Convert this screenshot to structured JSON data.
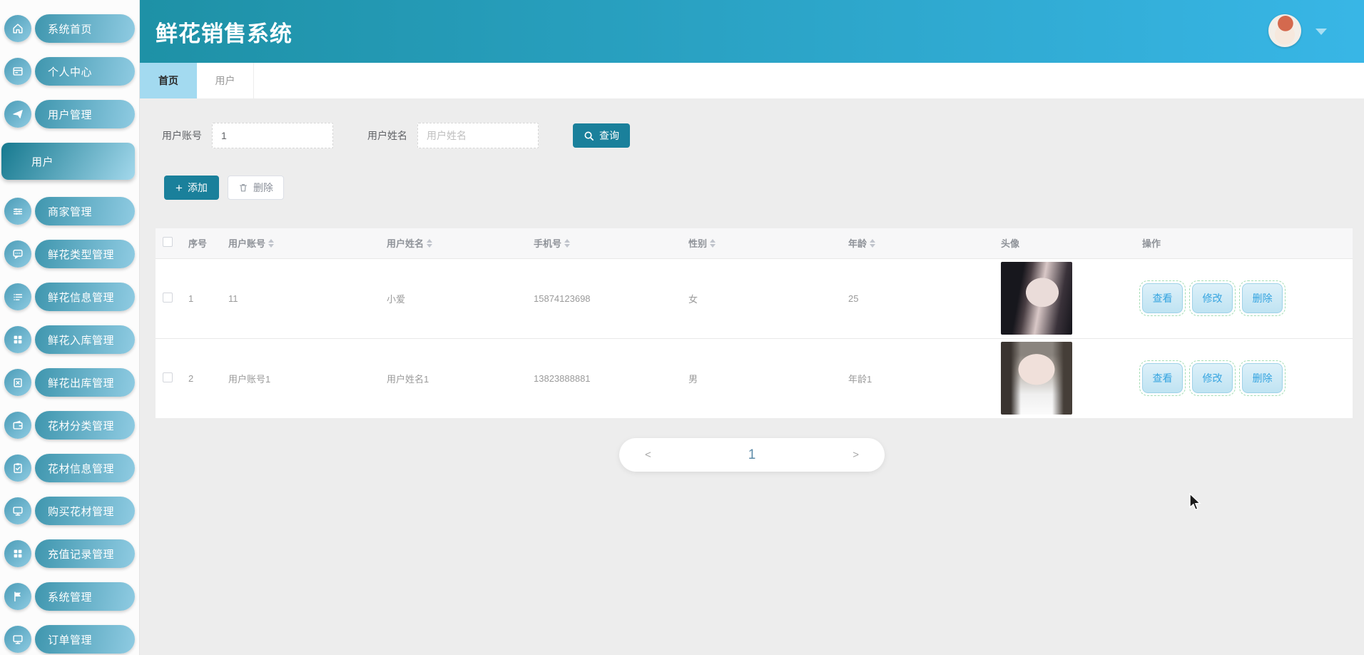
{
  "app": {
    "title": "鲜花销售系统"
  },
  "sidebar": {
    "items": [
      {
        "label": "系统首页"
      },
      {
        "label": "个人中心"
      },
      {
        "label": "用户管理"
      },
      {
        "label": "用户"
      },
      {
        "label": "商家管理"
      },
      {
        "label": "鲜花类型管理"
      },
      {
        "label": "鲜花信息管理"
      },
      {
        "label": "鲜花入库管理"
      },
      {
        "label": "鲜花出库管理"
      },
      {
        "label": "花材分类管理"
      },
      {
        "label": "花材信息管理"
      },
      {
        "label": "购买花材管理"
      },
      {
        "label": "充值记录管理"
      },
      {
        "label": "系统管理"
      },
      {
        "label": "订单管理"
      }
    ]
  },
  "tabs": {
    "home": "首页",
    "user": "用户"
  },
  "search": {
    "account_label": "用户账号",
    "account_value": "1",
    "name_label": "用户姓名",
    "name_placeholder": "用户姓名",
    "query_label": "查询"
  },
  "toolbar": {
    "add_label": "添加",
    "delete_label": "删除"
  },
  "table": {
    "columns": [
      "序号",
      "用户账号",
      "用户姓名",
      "手机号",
      "性别",
      "年龄",
      "头像",
      "操作"
    ],
    "row_actions": [
      "查看",
      "修改",
      "删除"
    ],
    "rows": [
      {
        "index": "1",
        "account": "11",
        "name": "小爱",
        "phone": "15874123698",
        "gender": "女",
        "age": "25"
      },
      {
        "index": "2",
        "account": "用户账号1",
        "name": "用户姓名1",
        "phone": "13823888881",
        "gender": "男",
        "age": "年龄1"
      }
    ]
  },
  "pagination": {
    "prev": "<",
    "page": "1",
    "next": ">"
  },
  "colors": {
    "header_gradient_left": "#1e91a6",
    "header_gradient_right": "#38b6e6",
    "accent_teal": "#1a809b",
    "tab_active_bg": "#a3daf0",
    "action_button_blue": "#35a4e0"
  }
}
